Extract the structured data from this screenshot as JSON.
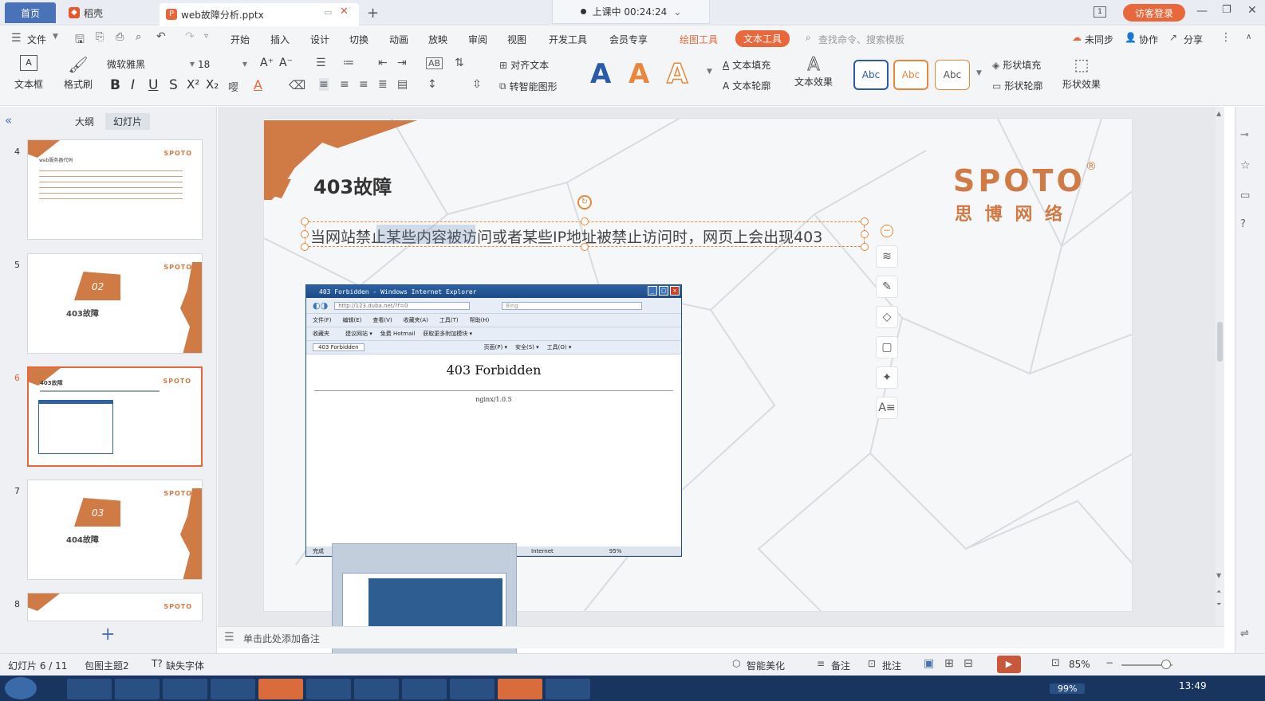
{
  "tabs": {
    "home": "首页",
    "shell": "稻壳",
    "document": "web故障分析.pptx",
    "new_tab": "+"
  },
  "class_timer": {
    "label": "上课中 00:24:24",
    "chevron": "⌄"
  },
  "window": {
    "badge": "1",
    "visitor_login": "访客登录"
  },
  "menu": {
    "file": "文件",
    "items": [
      "开始",
      "插入",
      "设计",
      "切换",
      "动画",
      "放映",
      "审阅",
      "视图",
      "开发工具",
      "会员专享"
    ],
    "drawing_tools": "绘图工具",
    "text_tools": "文本工具",
    "search_placeholder": "查找命令、搜索模板",
    "unsynced": "未同步",
    "collab": "协作",
    "share": "分享"
  },
  "ribbon": {
    "textbox": "文本框",
    "format_painter": "格式刷",
    "font_name": "微软雅黑",
    "font_size": "18",
    "align_text": "对齐文本",
    "smart_art": "转智能图形",
    "text_fill": "文本填充",
    "text_outline": "文本轮廓",
    "text_effect": "文本效果",
    "style_samples": [
      "Abc",
      "Abc",
      "Abc"
    ],
    "shape_fill": "形状填充",
    "shape_outline": "形状轮廓",
    "shape_effect": "形状效果",
    "bold": "B",
    "italic": "I",
    "underline": "U",
    "strike": "S",
    "superscript": "X²",
    "subscript": "X₂",
    "big_a": "A",
    "grow_font": "A⁺",
    "shrink_font": "A⁻"
  },
  "panel_tabs": {
    "outline": "大纲",
    "slides": "幻灯片"
  },
  "thumbnails": [
    {
      "number": "4",
      "title": "web服务器代码",
      "logo": "SPOTO",
      "accent": "#d07a45"
    },
    {
      "number": "5",
      "title": "403故障",
      "badge": "02",
      "logo": "SPOTO"
    },
    {
      "number": "6",
      "title": "403故障",
      "logo": "SPOTO",
      "selected": true
    },
    {
      "number": "7",
      "title": "404故障",
      "badge": "03",
      "logo": "SPOTO"
    },
    {
      "number": "8",
      "title": "",
      "logo": "SPOTO"
    }
  ],
  "slide": {
    "title": "403故障",
    "body": "当网站禁止某些内容被访问或者某些IP地址被禁止访问时，网页上会出现403",
    "logo_main": "SPOTO",
    "logo_registered": "®",
    "logo_sub": "思 博 网 络",
    "accent": "#d07a45"
  },
  "ie_window": {
    "title": "403 Forbidden - Windows Internet Explorer",
    "address": "http://123.duba.net/?f=0",
    "search_hint": "Bing",
    "menu": [
      "文件(F)",
      "编辑(E)",
      "查看(V)",
      "收藏夹(A)",
      "工具(T)",
      "帮助(H)"
    ],
    "favorites": [
      "收藏夹",
      "建议网站 ▾",
      "免费 Hotmail",
      "获取更多附加模块 ▾"
    ],
    "tab_title": "403 Forbidden",
    "tools": [
      "页面(P) ▾",
      "安全(S) ▾",
      "工具(O) ▾"
    ],
    "heading": "403 Forbidden",
    "server": "nginx/1.0.5",
    "status_left": "完成",
    "status_zone": "Internet",
    "status_zoom": "95%"
  },
  "notes_placeholder": "单击此处添加备注",
  "status": {
    "slide_index": "幻灯片 6 / 11",
    "theme": "包图主题2",
    "missing_font": "缺失字体",
    "beautify": "智能美化",
    "notes": "备注",
    "comment": "批注",
    "zoom": "85%",
    "tray_zoom": "99%",
    "clock": "13:49"
  },
  "colors": {
    "accent_orange": "#e8673b",
    "slide_orange": "#d07a45",
    "taskbar": "#17355f",
    "home_tab": "#4a72b8"
  }
}
